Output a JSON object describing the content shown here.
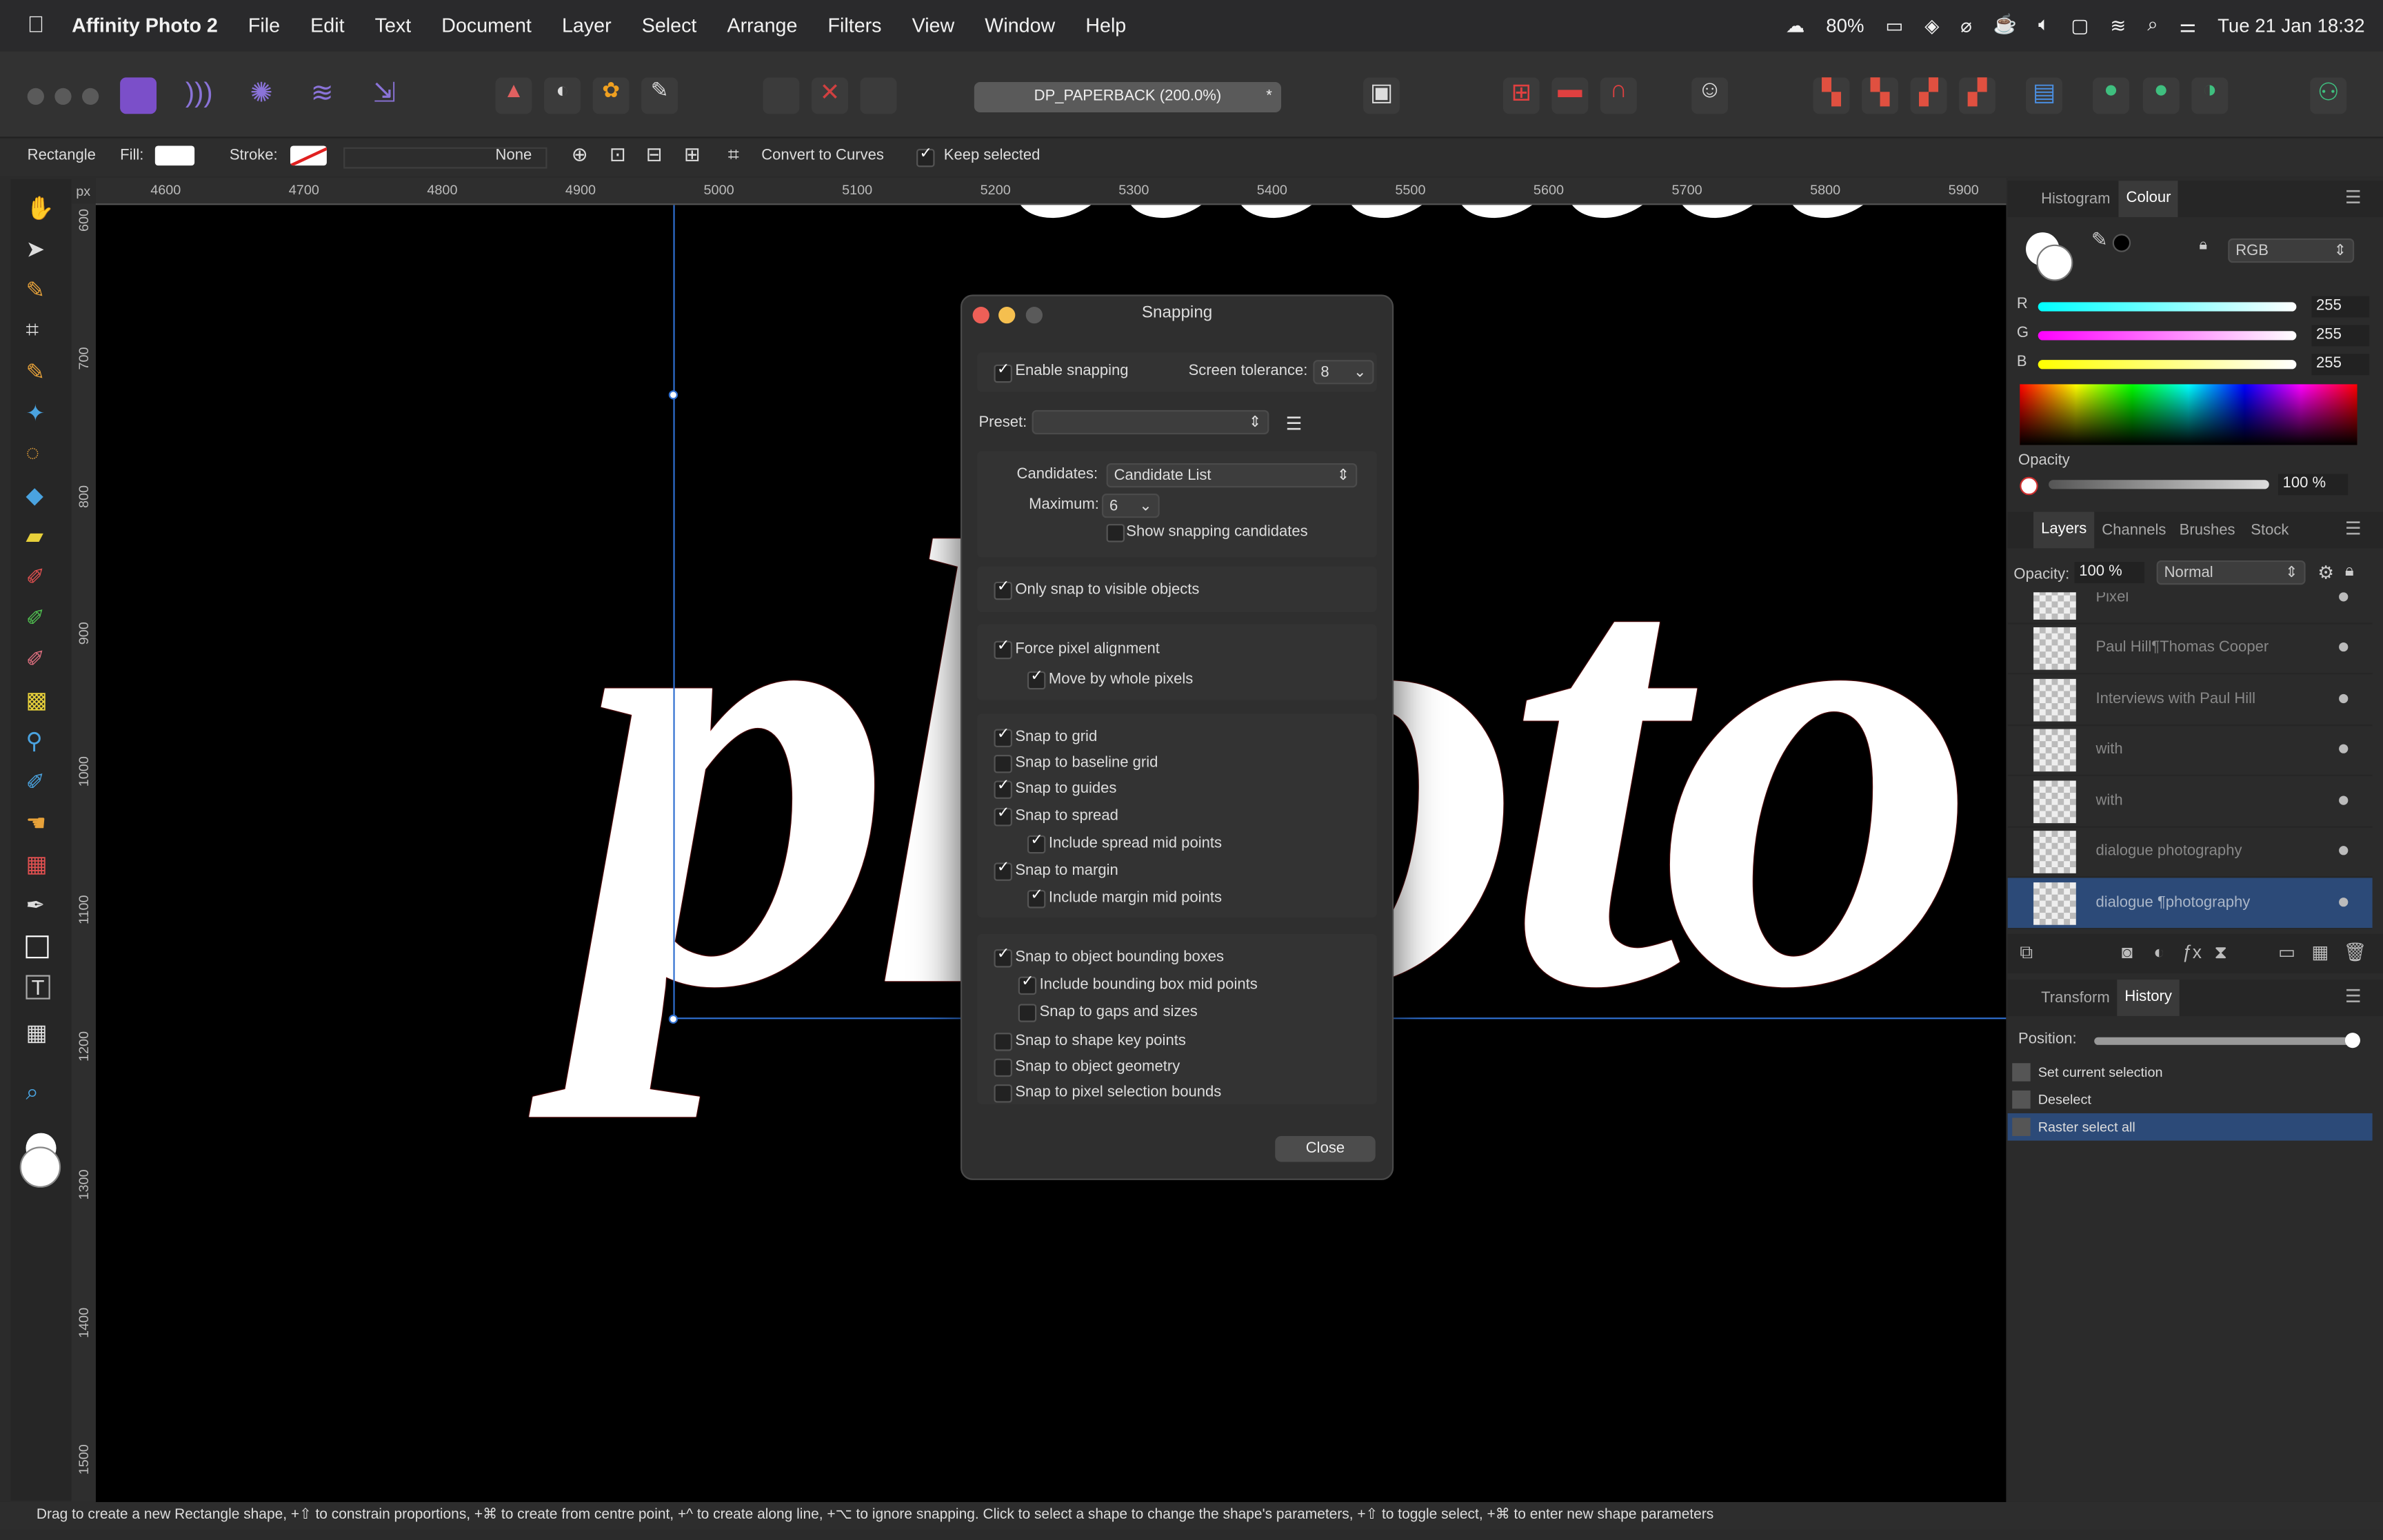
{
  "menubar": {
    "app": "Affinity Photo 2",
    "items": [
      "File",
      "Edit",
      "Text",
      "Document",
      "Layer",
      "Select",
      "Arrange",
      "Filters",
      "View",
      "Window",
      "Help"
    ],
    "battery": "80%",
    "datetime": "Tue 21 Jan  18:32"
  },
  "toolbar": {
    "document": "DP_PAPERBACK (200.0%)",
    "doc_star": "*"
  },
  "context": {
    "tool": "Rectangle",
    "fill_label": "Fill:",
    "stroke_label": "Stroke:",
    "stroke_value": "None",
    "convert": "Convert to Curves",
    "keep_selected": "Keep selected"
  },
  "ruler": {
    "unit": "px",
    "top": [
      "4600",
      "4700",
      "4800",
      "4900",
      "5000",
      "5100",
      "5200",
      "5300",
      "5400",
      "5500",
      "5600",
      "5700",
      "5800",
      "5900"
    ],
    "left": [
      "600",
      "700",
      "800",
      "900",
      "1000",
      "1100",
      "1200",
      "1300",
      "1400",
      "1500"
    ]
  },
  "canvas": {
    "text_main": "photo",
    "text_top": "eeeeeeee"
  },
  "dialog": {
    "title": "Snapping",
    "enable_snapping": "Enable snapping",
    "screen_tolerance_label": "Screen tolerance:",
    "screen_tolerance": "8",
    "preset_label": "Preset:",
    "preset_value": "",
    "candidates_label": "Candidates:",
    "candidates_value": "Candidate List",
    "maximum_label": "Maximum:",
    "maximum_value": "6",
    "show_candidates": "Show snapping candidates",
    "only_visible": "Only snap to visible objects",
    "force_pixel": "Force pixel alignment",
    "whole_pixels": "Move by whole pixels",
    "snap_grid": "Snap to grid",
    "snap_baseline": "Snap to baseline grid",
    "snap_guides": "Snap to guides",
    "snap_spread": "Snap to spread",
    "spread_mid": "Include spread mid points",
    "snap_margin": "Snap to margin",
    "margin_mid": "Include margin mid points",
    "snap_bbox": "Snap to object bounding boxes",
    "bbox_mid": "Include bounding box mid points",
    "gaps_sizes": "Snap to gaps and sizes",
    "shape_key": "Snap to shape key points",
    "object_geometry": "Snap to object geometry",
    "pixel_bounds": "Snap to pixel selection bounds",
    "close": "Close"
  },
  "colour_panel": {
    "tabs": [
      "Histogram",
      "Colour"
    ],
    "mode": "RGB",
    "r_label": "R",
    "g_label": "G",
    "b_label": "B",
    "r": "255",
    "g": "255",
    "b": "255",
    "opacity_label": "Opacity",
    "opacity": "100 %"
  },
  "layers_panel": {
    "tabs": [
      "Layers",
      "Channels",
      "Brushes",
      "Stock"
    ],
    "opacity_label": "Opacity:",
    "opacity": "100 %",
    "blend": "Normal",
    "layers": [
      "Pixel",
      "Paul Hill¶Thomas Cooper",
      "Interviews with Paul Hill",
      "with",
      "with",
      "dialogue      photography",
      "dialogue ¶photography"
    ]
  },
  "history_panel": {
    "tabs": [
      "Transform",
      "History"
    ],
    "position_label": "Position:",
    "position": 1.0,
    "items": [
      "Set current selection",
      "Deselect",
      "Raster select all"
    ]
  },
  "status": {
    "text": "Drag to create a new Rectangle shape, +⇧ to constrain proportions, +⌘ to create from centre point, +^ to create along line, +⌥ to ignore snapping. Click to select a shape to change the shape's parameters, +⇧ to toggle select, +⌘ to enter new shape parameters"
  },
  "colors": {
    "accent": "#2f6fd0",
    "selected_row": "#2c4a78",
    "red_close": "#ed5f57",
    "yellow_min": "#f5bf4f"
  }
}
